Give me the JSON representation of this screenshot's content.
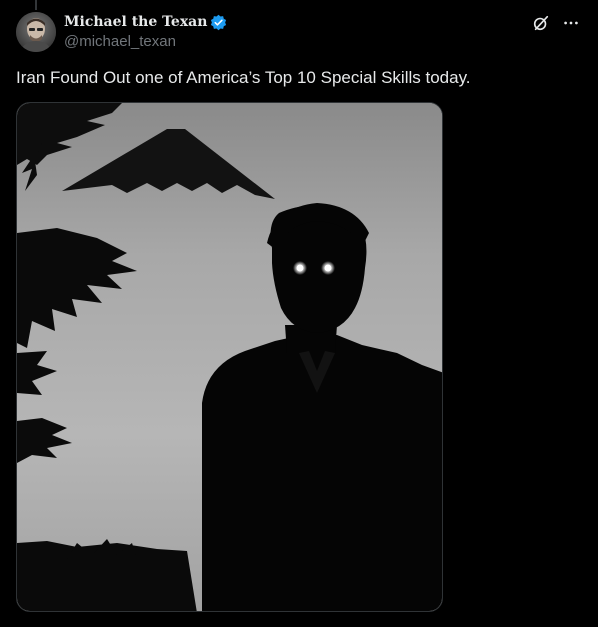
{
  "tweet": {
    "author": {
      "display_name": "Michael the Texan",
      "handle": "@michael_texan",
      "verified": true,
      "verified_color": "#1d9bf0"
    },
    "text": "Iran Found Out one of America’s Top 10 Special Skills today.",
    "icons": {
      "grok": "grok-icon",
      "more": "more-icon"
    },
    "colors": {
      "background": "#000000",
      "text": "#e7e9ea",
      "secondary_text": "#71767b",
      "border": "#2f3336"
    }
  }
}
